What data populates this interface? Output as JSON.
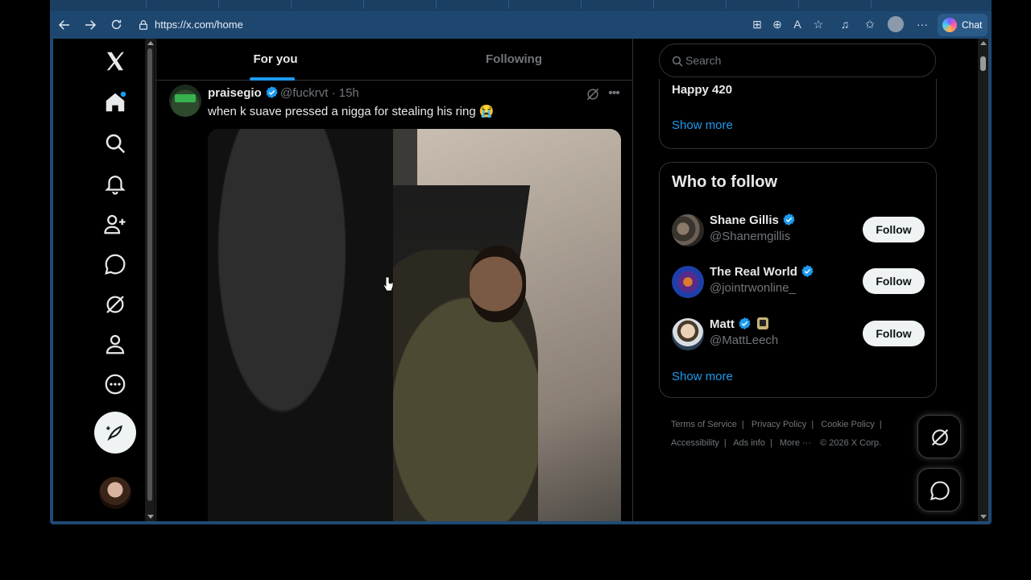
{
  "browser": {
    "url": "https://x.com/home",
    "chat_label": "Chat"
  },
  "feed": {
    "tabs": [
      {
        "label": "For you",
        "selected": true
      },
      {
        "label": "Following",
        "selected": false
      }
    ]
  },
  "tweet": {
    "author_name": "praisegio",
    "handle_time": "@fuckrvt · 15h",
    "text": "when k suave pressed a nigga for stealing his ring 😭"
  },
  "trend": {
    "title": "Happy 420",
    "show_more": "Show more"
  },
  "who_to_follow": {
    "title": "Who to follow",
    "users": [
      {
        "name": "Shane Gillis",
        "handle": "@Shanemgillis",
        "button": "Follow"
      },
      {
        "name": "The Real World",
        "handle": "@jointrwonline_",
        "button": "Follow"
      },
      {
        "name": "Matt",
        "handle": "@MattLeech",
        "button": "Follow"
      }
    ],
    "show_more": "Show more"
  },
  "search": {
    "placeholder": "Search"
  },
  "footer": {
    "links": [
      "Terms of Service",
      "Privacy Policy",
      "Cookie Policy",
      "Accessibility",
      "Ads info",
      "More ···"
    ],
    "copyright": "© 2026 X Corp."
  },
  "colors": {
    "accent": "#1d9bf0",
    "verified": "#1d9bf0",
    "background": "#000000",
    "text": "#e7e9ea",
    "secondary_text": "#71767b"
  }
}
